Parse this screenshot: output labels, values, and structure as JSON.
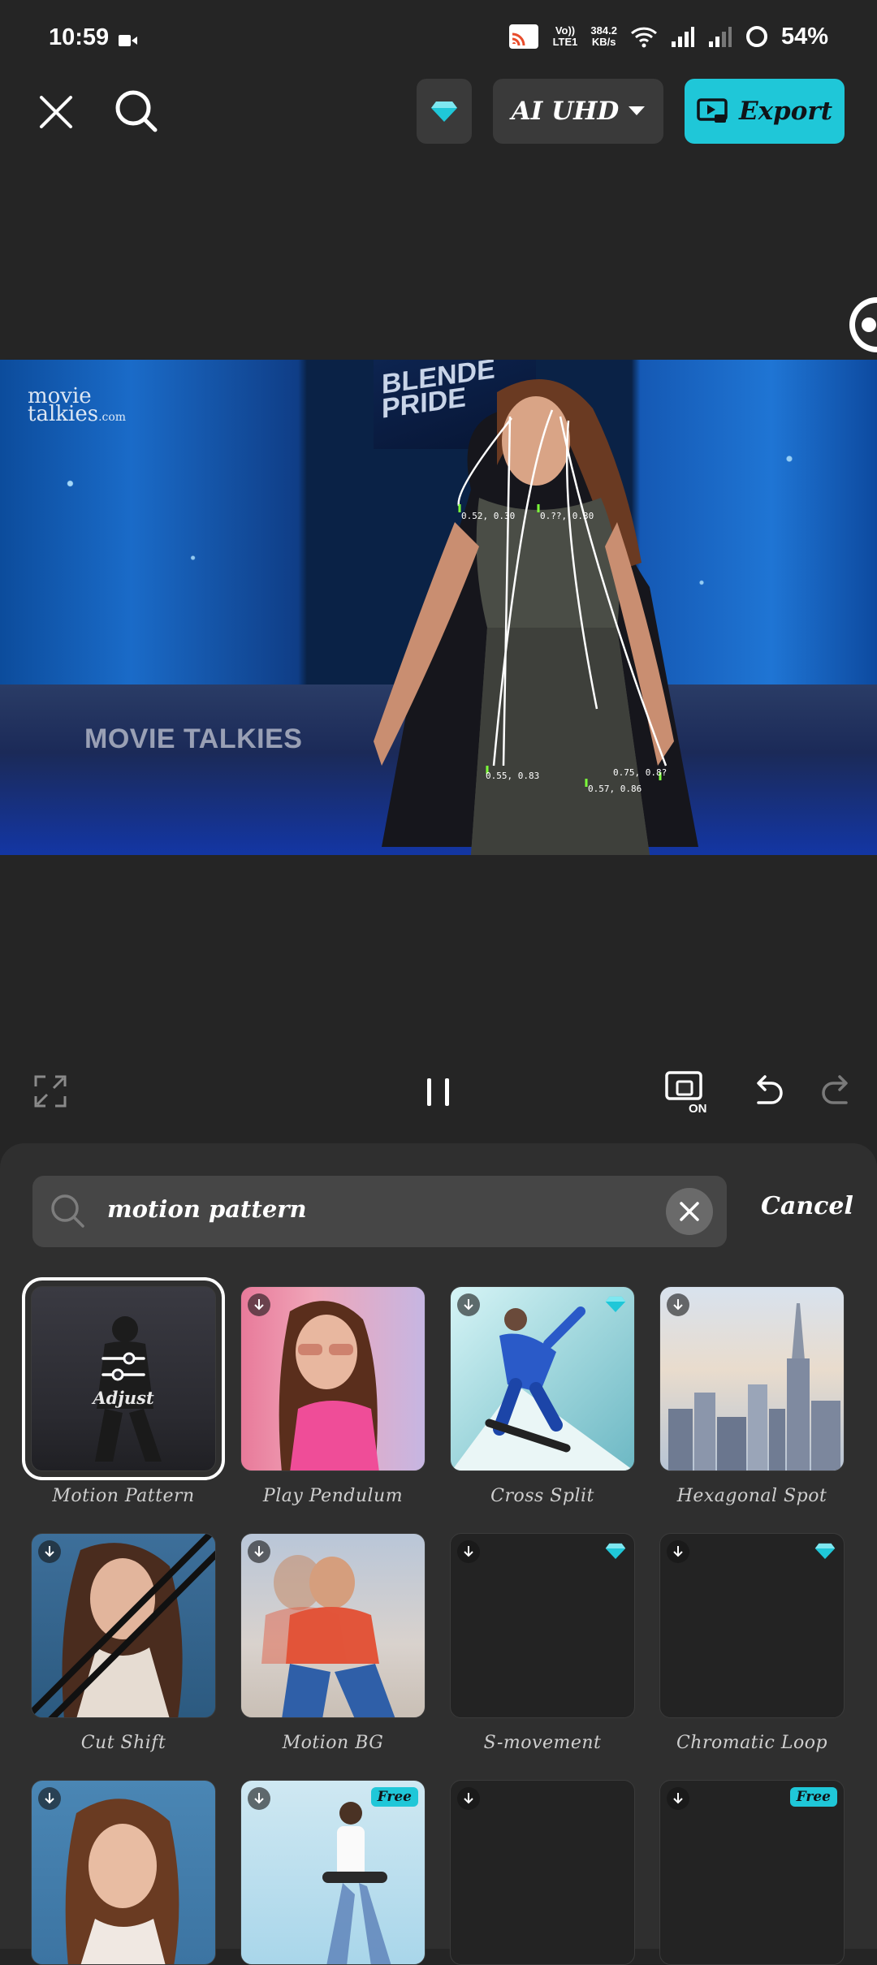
{
  "status_bar": {
    "time": "10:59",
    "net_top": "Vo))",
    "net_bottom": "LTE1",
    "speed_top": "384.2",
    "speed_bottom": "KB/s",
    "battery": "54%"
  },
  "toolbar": {
    "quality_label": "AI UHD",
    "export_label": "Export",
    "accent": "#1fc7d8"
  },
  "preview": {
    "watermark_top_1": "movie",
    "watermark_top_2": "talkies",
    "watermark_top_3": ".com",
    "watermark_bottom": "MOVIE TALKIES",
    "banner_1": "BLENDE",
    "banner_2": "PRIDE",
    "coords": [
      "0.52, 0.30",
      "0.??, 0.30",
      "0.55, 0.83",
      "0.57, 0.86",
      "0.75, 0.8?"
    ]
  },
  "search": {
    "value": "motion pattern",
    "cancel_label": "Cancel"
  },
  "effects": [
    {
      "name": "Motion Pattern",
      "overlay": "Adjust",
      "selected": true
    },
    {
      "name": "Play Pendulum"
    },
    {
      "name": "Cross Split",
      "pro": true
    },
    {
      "name": "Hexagonal Spot"
    },
    {
      "name": "Cut Shift"
    },
    {
      "name": "Motion BG"
    },
    {
      "name": "S-movement",
      "pro": true
    },
    {
      "name": "Chromatic Loop",
      "pro": true
    },
    {
      "name": ""
    },
    {
      "name": "",
      "badge": "Free"
    },
    {
      "name": ""
    },
    {
      "name": "",
      "badge": "Free"
    }
  ]
}
